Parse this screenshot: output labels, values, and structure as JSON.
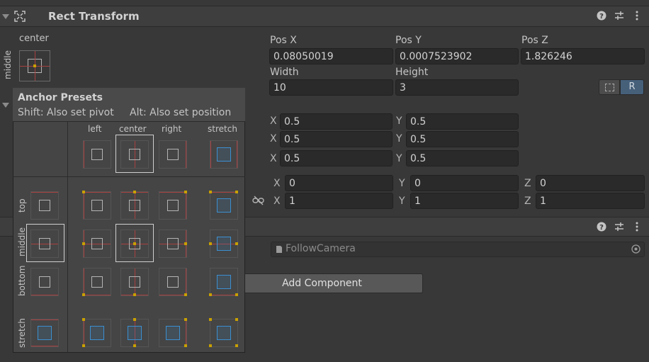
{
  "header": {
    "title": "Rect Transform"
  },
  "anchor_widget": {
    "top_label": "center",
    "side_label": "middle"
  },
  "fields": {
    "pos_x_label": "Pos X",
    "pos_y_label": "Pos Y",
    "pos_z_label": "Pos Z",
    "pos_x": "0.08050019",
    "pos_y": "0.0007523902",
    "pos_z": "1.826246",
    "width_label": "Width",
    "height_label": "Height",
    "width": "10",
    "height": "3",
    "r_button": "R"
  },
  "anchors": {
    "min": {
      "x_label": "X",
      "x": "0.5",
      "y_label": "Y",
      "y": "0.5"
    },
    "max": {
      "x_label": "X",
      "x": "0.5",
      "y_label": "Y",
      "y": "0.5"
    },
    "pivot": {
      "x_label": "X",
      "x": "0.5",
      "y_label": "Y",
      "y": "0.5"
    }
  },
  "rotation": {
    "x_label": "X",
    "x": "0",
    "y_label": "Y",
    "y": "0",
    "z_label": "Z",
    "z": "0"
  },
  "scale": {
    "x_label": "X",
    "x": "1",
    "y_label": "Y",
    "y": "1",
    "z_label": "Z",
    "z": "1"
  },
  "script": {
    "value": "FollowCamera"
  },
  "add_component": "Add Component",
  "popup": {
    "title": "Anchor Presets",
    "hint_left": "Shift: Also set pivot",
    "hint_right": "Alt: Also set position",
    "cols": [
      "left",
      "center",
      "right",
      "stretch"
    ],
    "rows": [
      "top",
      "middle",
      "bottom",
      "stretch"
    ]
  },
  "colors": {
    "accent_blue": "#3b8fd0",
    "anchor_red": "#a84040",
    "anchor_yellow": "#c8a000"
  }
}
